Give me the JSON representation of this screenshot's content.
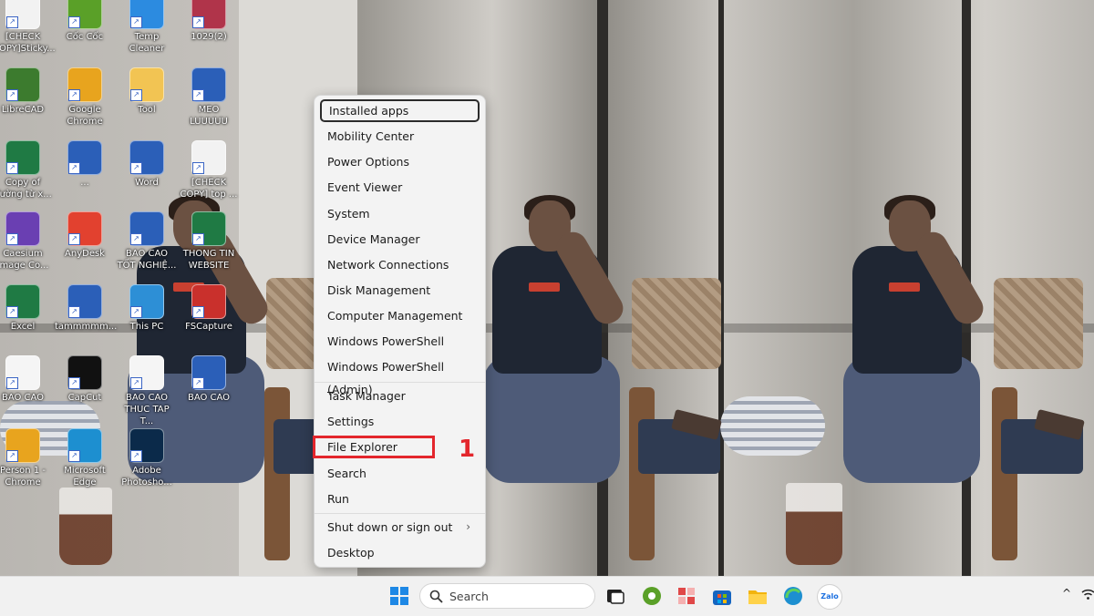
{
  "desktop_icons": [
    {
      "label": "[CHECK COPY]Sticky...",
      "color": "#f2f2f2"
    },
    {
      "label": "Cốc Cốc",
      "color": "#5aa028"
    },
    {
      "label": "Temp Cleaner",
      "color": "#2c8be0"
    },
    {
      "label": "1029(2)",
      "color": "#b0344a"
    },
    {
      "label": "LibreCAD",
      "color": "#3c7b2e"
    },
    {
      "label": "Google Chrome",
      "color": "#e8a41e"
    },
    {
      "label": "Tool",
      "color": "#f2c453"
    },
    {
      "label": "MEO LUUUUU",
      "color": "#2b5fb8"
    },
    {
      "label": "Copy of đường từ x...",
      "color": "#1f7a44"
    },
    {
      "label": "...",
      "color": "#2b5fb8"
    },
    {
      "label": "Word",
      "color": "#2b5fb8"
    },
    {
      "label": "[CHECK COPY] top ...",
      "color": "#f2f2f2"
    },
    {
      "label": "Caesium Image Co...",
      "color": "#6a3fb2"
    },
    {
      "label": "AnyDesk",
      "color": "#e2412f"
    },
    {
      "label": "BAO CAO TỐT NGHIỆ...",
      "color": "#2b5fb8"
    },
    {
      "label": "THONG TIN WEBSITE",
      "color": "#1f7a44"
    },
    {
      "label": "Excel",
      "color": "#1f7a44"
    },
    {
      "label": "tammmmm...",
      "color": "#2b5fb8"
    },
    {
      "label": "This PC",
      "color": "#2d8fd6"
    },
    {
      "label": "FSCapture",
      "color": "#c9302c"
    },
    {
      "label": "BAO CAO",
      "color": "#f5f5f5"
    },
    {
      "label": "CapCut",
      "color": "#111111"
    },
    {
      "label": "BAO CAO THUC TAP T...",
      "color": "#f5f5f5"
    },
    {
      "label": "BAO CAO",
      "color": "#2b5fb8"
    },
    {
      "label": "Person 1 - Chrome",
      "color": "#e8a41e"
    },
    {
      "label": "Microsoft Edge",
      "color": "#1d8fd0"
    },
    {
      "label": "Adobe Photosho...",
      "color": "#0b2a4a"
    }
  ],
  "menu": {
    "items": [
      {
        "label": "Installed apps"
      },
      {
        "label": "Mobility Center"
      },
      {
        "label": "Power Options"
      },
      {
        "label": "Event Viewer"
      },
      {
        "label": "System"
      },
      {
        "label": "Device Manager"
      },
      {
        "label": "Network Connections"
      },
      {
        "label": "Disk Management"
      },
      {
        "label": "Computer Management"
      },
      {
        "label": "Windows PowerShell"
      },
      {
        "label": "Windows PowerShell (Admin)"
      },
      {
        "label": "Task Manager"
      },
      {
        "label": "Settings"
      },
      {
        "label": "File Explorer"
      },
      {
        "label": "Search"
      },
      {
        "label": "Run"
      },
      {
        "label": "Shut down or sign out"
      },
      {
        "label": "Desktop"
      }
    ],
    "submenu_arrow": "›"
  },
  "annotation": {
    "step": "1",
    "color": "#e3262c"
  },
  "taskbar": {
    "search_label": "Search",
    "apps": [
      "start",
      "task-view",
      "coc-coc",
      "app-grid",
      "microsoft-store",
      "file-explorer",
      "edge",
      "zalo"
    ],
    "zalo_label": "Zalo",
    "tray_chevron": "^"
  }
}
